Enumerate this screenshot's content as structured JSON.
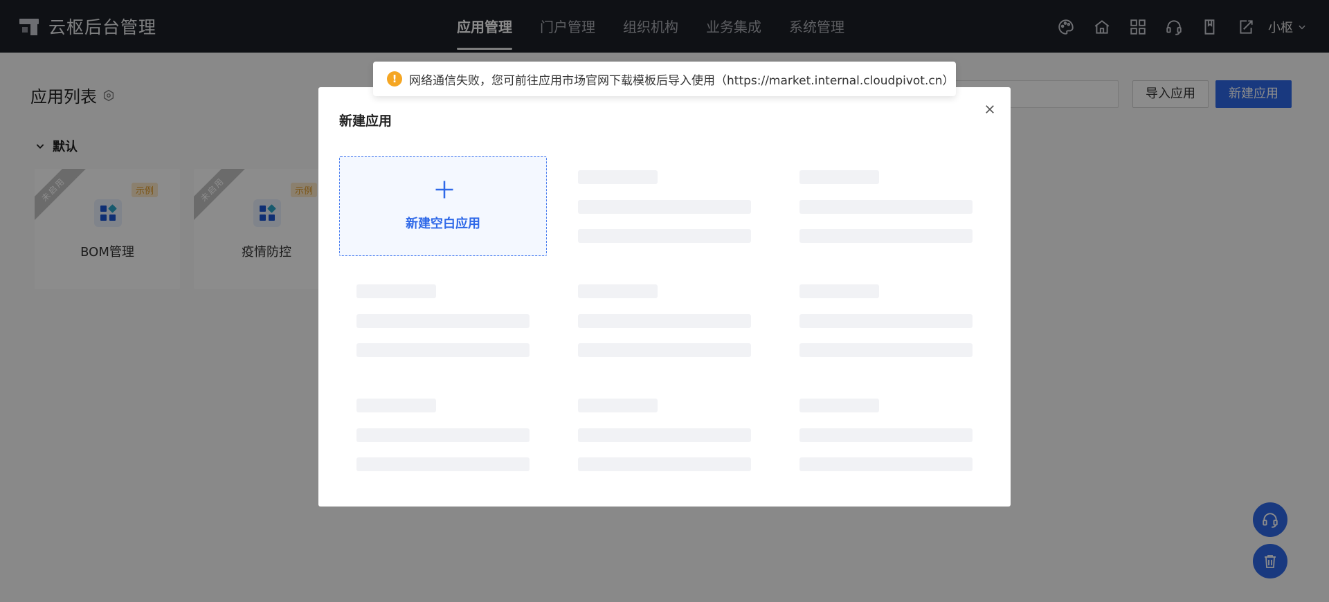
{
  "app": {
    "title": "云枢后台管理"
  },
  "nav": {
    "items": [
      {
        "label": "应用管理",
        "active": true
      },
      {
        "label": "门户管理"
      },
      {
        "label": "组织机构"
      },
      {
        "label": "业务集成"
      },
      {
        "label": "系统管理"
      }
    ]
  },
  "toolbar": {
    "icons": [
      "palette-icon",
      "home-icon",
      "apps-grid-icon",
      "headset-icon",
      "book-icon",
      "export-icon"
    ],
    "user_name": "小枢"
  },
  "page": {
    "title": "应用列表",
    "search_placeholder": "",
    "import_label": "导入应用",
    "new_label": "新建应用",
    "group_label": "默认"
  },
  "apps": [
    {
      "name": "BOM管理",
      "ribbon": "未启用",
      "tag": "示例"
    },
    {
      "name": "疫情防控",
      "ribbon": "未启用",
      "tag": "示例"
    }
  ],
  "toast": {
    "type": "warning",
    "icon_text": "!",
    "message": "网络通信失败，您可前往应用市场官网下载模板后导入使用（https://market.internal.cloudpivot.cn）"
  },
  "modal": {
    "title": "新建应用",
    "blank_label": "新建空白应用",
    "templates_loading": true
  },
  "colors": {
    "primary": "#2e68e8",
    "topbar": "#1d2027",
    "warning": "#f5a623",
    "skeleton": "#f1f2f5"
  }
}
